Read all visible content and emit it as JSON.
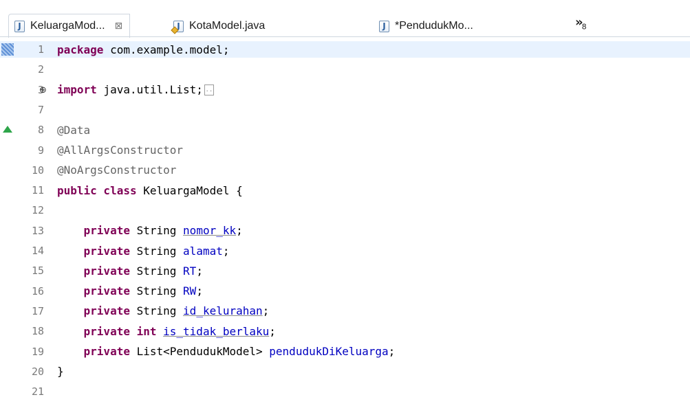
{
  "tabs": [
    {
      "label": "KeluargaMod...",
      "icon": "java-file-icon",
      "active": true,
      "closable": true
    },
    {
      "label": "KotaModel.java",
      "icon": "java-file-warning-icon",
      "active": false
    },
    {
      "label": "*PendudukMo...",
      "icon": "java-file-icon",
      "active": false
    }
  ],
  "overflow": {
    "chevron": "»",
    "count": "8"
  },
  "close_glyph": "⊠",
  "editor": {
    "fold_glyph": "⊕",
    "lines": [
      {
        "no": "1",
        "current": true,
        "parts": [
          [
            "kw",
            "package"
          ],
          [
            "",
            "com.example.model;"
          ]
        ]
      },
      {
        "no": "2",
        "parts": []
      },
      {
        "no": "3",
        "fold": true,
        "parts": [
          [
            "kw",
            "import"
          ],
          [
            "",
            "java.util.List;"
          ],
          [
            "box",
            ".."
          ]
        ]
      },
      {
        "no": "7",
        "parts": []
      },
      {
        "no": "8",
        "marker": "triangle",
        "parts": [
          [
            "ann",
            "@Data"
          ]
        ]
      },
      {
        "no": "9",
        "parts": [
          [
            "ann",
            "@AllArgsConstructor"
          ]
        ]
      },
      {
        "no": "10",
        "parts": [
          [
            "ann",
            "@NoArgsConstructor"
          ]
        ]
      },
      {
        "no": "11",
        "parts": [
          [
            "kw",
            "public class"
          ],
          [
            "",
            "KeluargaModel {"
          ]
        ]
      },
      {
        "no": "12",
        "parts": []
      },
      {
        "no": "13",
        "parts": [
          [
            "indent",
            "    "
          ],
          [
            "kw",
            "private"
          ],
          [
            "",
            "String"
          ],
          [
            "fld",
            "nomor_kk"
          ],
          [
            "semi",
            ";"
          ]
        ]
      },
      {
        "no": "14",
        "parts": [
          [
            "indent",
            "    "
          ],
          [
            "kw",
            "private"
          ],
          [
            "",
            "String"
          ],
          [
            "fld",
            "alamat"
          ],
          [
            "semi",
            ";"
          ]
        ]
      },
      {
        "no": "15",
        "parts": [
          [
            "indent",
            "    "
          ],
          [
            "kw",
            "private"
          ],
          [
            "",
            "String"
          ],
          [
            "fld",
            "RT"
          ],
          [
            "semi",
            ";"
          ]
        ]
      },
      {
        "no": "16",
        "parts": [
          [
            "indent",
            "    "
          ],
          [
            "kw",
            "private"
          ],
          [
            "",
            "String"
          ],
          [
            "fld",
            "RW"
          ],
          [
            "semi",
            ";"
          ]
        ]
      },
      {
        "no": "17",
        "parts": [
          [
            "indent",
            "    "
          ],
          [
            "kw",
            "private"
          ],
          [
            "",
            "String"
          ],
          [
            "fld",
            "id_kelurahan"
          ],
          [
            "semi",
            ";"
          ]
        ]
      },
      {
        "no": "18",
        "parts": [
          [
            "indent",
            "    "
          ],
          [
            "kw",
            "private int"
          ],
          [
            "fld",
            "is_tidak_berlaku"
          ],
          [
            "semi",
            ";"
          ]
        ]
      },
      {
        "no": "19",
        "parts": [
          [
            "indent",
            "    "
          ],
          [
            "kw",
            "private"
          ],
          [
            "",
            "List<PendudukModel>"
          ],
          [
            "fld",
            "pendudukDiKeluarga"
          ],
          [
            "semi",
            ";"
          ]
        ]
      },
      {
        "no": "20",
        "parts": [
          [
            "",
            "}"
          ]
        ]
      },
      {
        "no": "21",
        "parts": []
      }
    ]
  }
}
